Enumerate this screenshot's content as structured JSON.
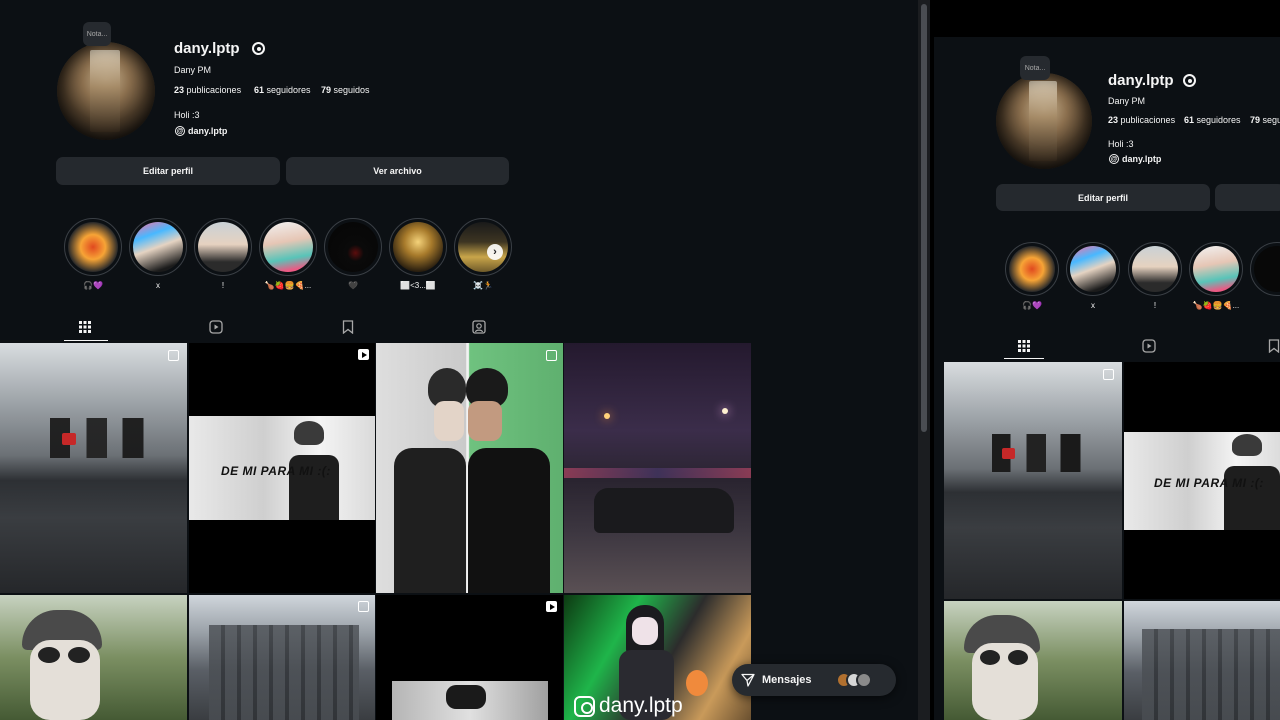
{
  "profile": {
    "note_label": "Nota...",
    "username": "dany.lptp",
    "full_name": "Dany PM",
    "posts_count": "23",
    "posts_label": "publicaciones",
    "followers_count": "61",
    "followers_label": "seguidores",
    "following_count": "79",
    "following_label": "seguidos",
    "bio": "Holi :3",
    "threads_handle": "dany.lptp"
  },
  "buttons": {
    "edit_profile": "Editar perfil",
    "view_archive": "Ver archivo"
  },
  "highlights": [
    {
      "label": "🎧💜"
    },
    {
      "label": "x"
    },
    {
      "label": "!"
    },
    {
      "label": "🍗🍓🍔🍕..."
    },
    {
      "label": "🖤"
    },
    {
      "label": "⬜<3...⬜"
    },
    {
      "label": "☠️🏃"
    }
  ],
  "tabs": [
    "posts-grid",
    "reels",
    "saved",
    "tagged"
  ],
  "posts": {
    "caption_text": "DE MI PARA MI :(:",
    "watermark_text": "dany.lptp"
  },
  "messages": {
    "label": "Mensajes"
  },
  "colors": {
    "background": "#0c1014",
    "button_bg": "#25292e",
    "text": "#f5f5f5"
  }
}
